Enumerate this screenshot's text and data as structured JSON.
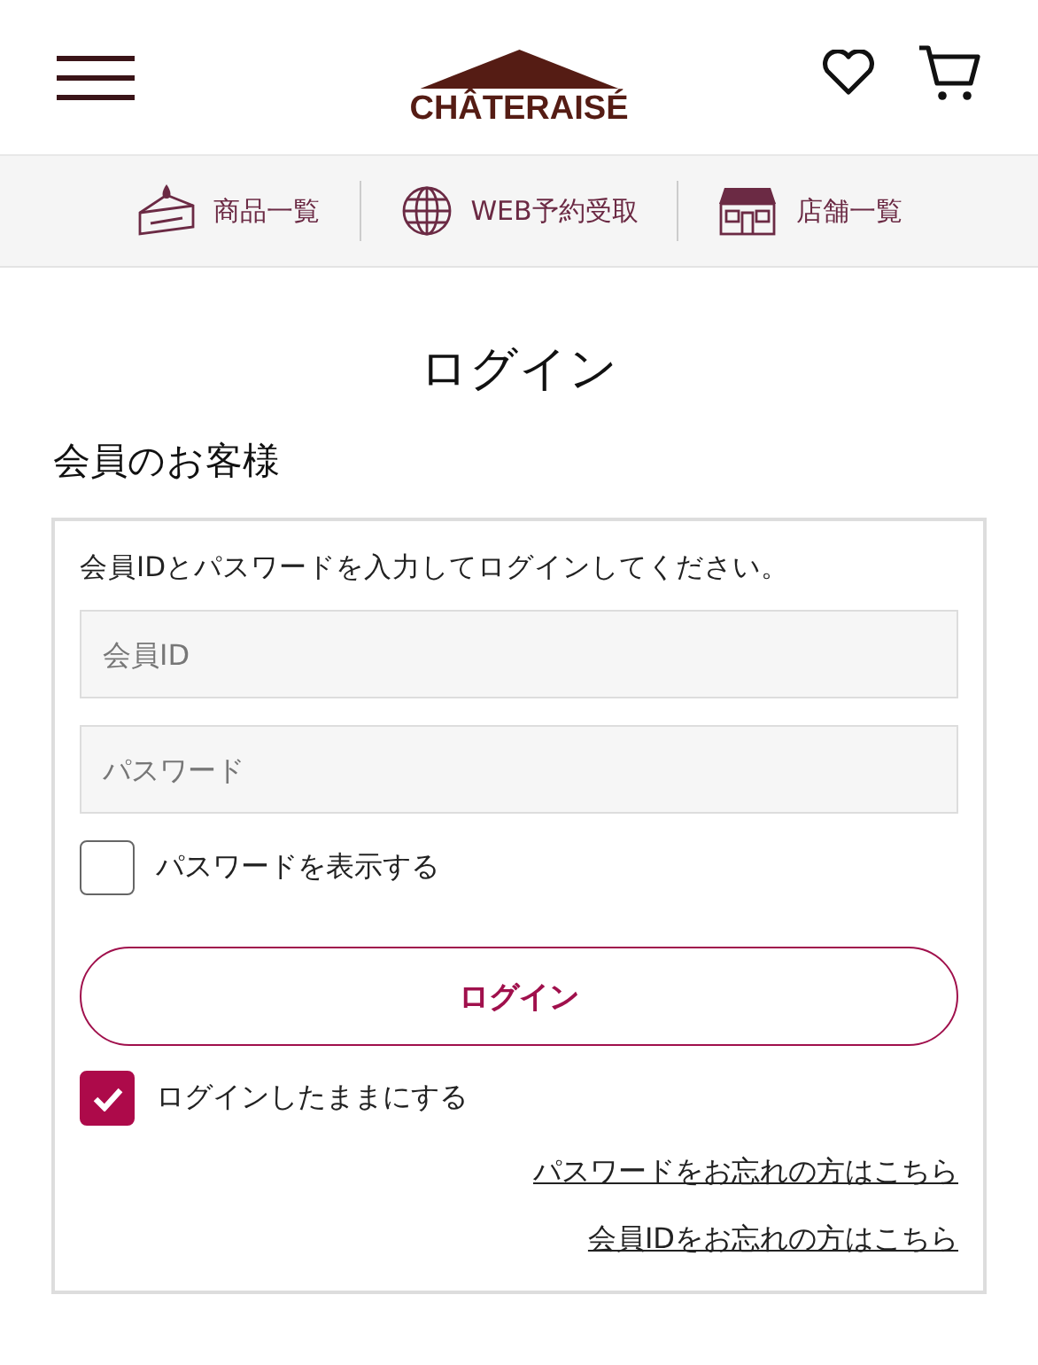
{
  "header": {
    "logo": "CHÂTERAISÉ"
  },
  "nav": [
    {
      "label": "商品一覧"
    },
    {
      "label": "WEB予約受取"
    },
    {
      "label": "店舗一覧"
    }
  ],
  "page_title": "ログイン",
  "section_title": "会員のお客様",
  "login_card": {
    "instruction": "会員IDとパスワードを入力してログインしてください。",
    "fields": [
      {
        "placeholder": "会員ID"
      },
      {
        "placeholder": "パスワード"
      }
    ],
    "show_password": {
      "label": "パスワードを表示する",
      "checked": false
    },
    "login_button": "ログイン",
    "stay_logged_in": {
      "label": "ログインしたままにする",
      "checked": true
    },
    "links": [
      "パスワードをお忘れの方はこちら",
      "会員IDをお忘れの方はこちら"
    ]
  }
}
